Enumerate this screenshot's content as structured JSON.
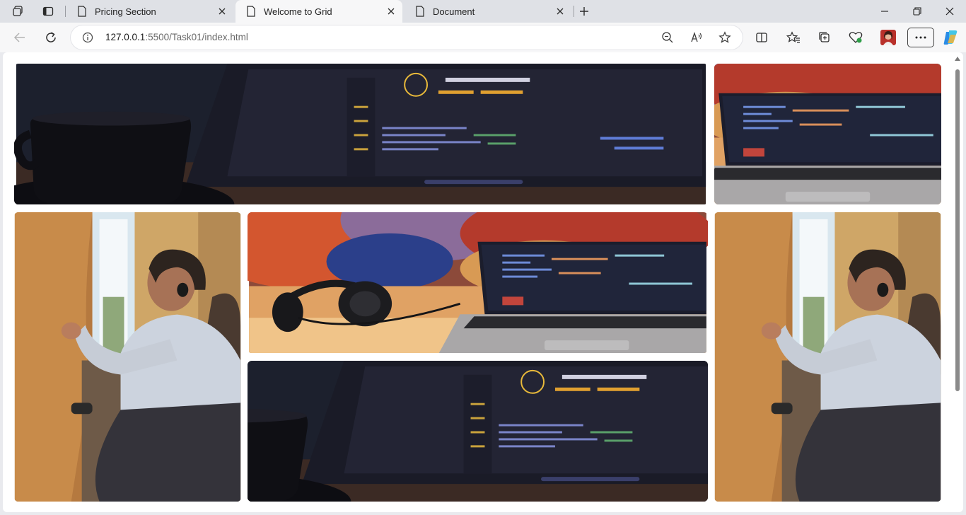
{
  "tabs": [
    {
      "title": "Pricing Section",
      "active": false
    },
    {
      "title": "Welcome to Grid",
      "active": true
    },
    {
      "title": "Document",
      "active": false
    }
  ],
  "toolbar": {
    "url_host": "127.0.0.1",
    "url_rest": ":5500/Task01/index.html"
  },
  "icons": {
    "workspaces": "workspaces-icon",
    "tab_actions": "tab-actions-icon",
    "new_tab": "plus-icon",
    "minimize": "minimize-icon",
    "restore": "restore-icon",
    "close": "close-icon",
    "back": "back-arrow-icon",
    "refresh": "refresh-icon",
    "info": "info-icon",
    "zoom": "zoom-out-icon",
    "read_aloud": "read-aloud-icon",
    "favorite": "star-icon",
    "split": "split-screen-icon",
    "favorites": "favorites-icon",
    "collections": "collections-icon",
    "health": "browser-essentials-icon",
    "profile": "profile-avatar",
    "more": "more-icon",
    "copilot": "copilot-icon"
  },
  "gallery": {
    "images": [
      {
        "subject": "laptop-code-editor-with-coffee-cup"
      },
      {
        "subject": "laptop-with-headphones-on-desk"
      },
      {
        "subject": "man-sitting-by-window"
      },
      {
        "subject": "laptop-with-headphones-on-desk"
      },
      {
        "subject": "man-sitting-by-window"
      },
      {
        "subject": "laptop-code-editor-with-coffee-cup"
      }
    ]
  },
  "colors": {
    "accent": "#0f6cbd",
    "page_bg": "#ffffff",
    "chrome_bg": "#dfe1e6"
  }
}
